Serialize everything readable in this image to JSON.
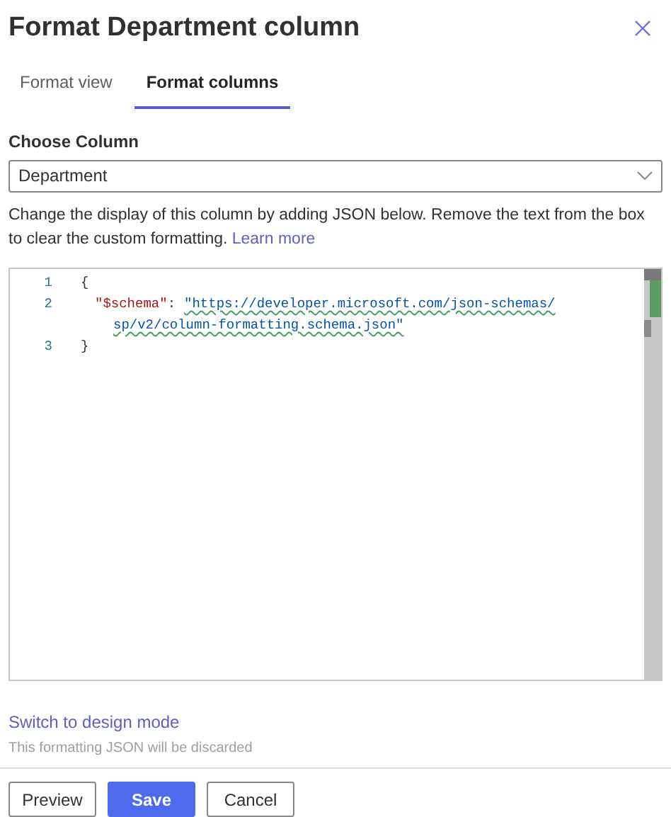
{
  "panel": {
    "title": "Format Department column"
  },
  "tabs": [
    {
      "label": "Format view",
      "selected": false
    },
    {
      "label": "Format columns",
      "selected": true
    }
  ],
  "column_picker": {
    "label": "Choose Column",
    "value": "Department"
  },
  "description": {
    "text": "Change the display of this column by adding JSON below. Remove the text from the box to clear the custom formatting.",
    "link": "Learn more"
  },
  "editor": {
    "lines": [
      {
        "number": "1",
        "kind": "punct",
        "text": "{"
      },
      {
        "number": "2",
        "kind": "pair",
        "key": "\"$schema\"",
        "sep": ":",
        "value_lines": [
          "\"https://developer.microsoft.com/json-schemas/",
          "sp/v2/column-formatting.schema.json\""
        ]
      },
      {
        "number": "3",
        "kind": "punct",
        "text": "}"
      }
    ]
  },
  "design_mode": {
    "link": "Switch to design mode",
    "note": "This formatting JSON will be discarded"
  },
  "buttons": [
    {
      "label": "Preview",
      "kind": "default"
    },
    {
      "label": "Save",
      "kind": "primary"
    },
    {
      "label": "Cancel",
      "kind": "default"
    }
  ]
}
